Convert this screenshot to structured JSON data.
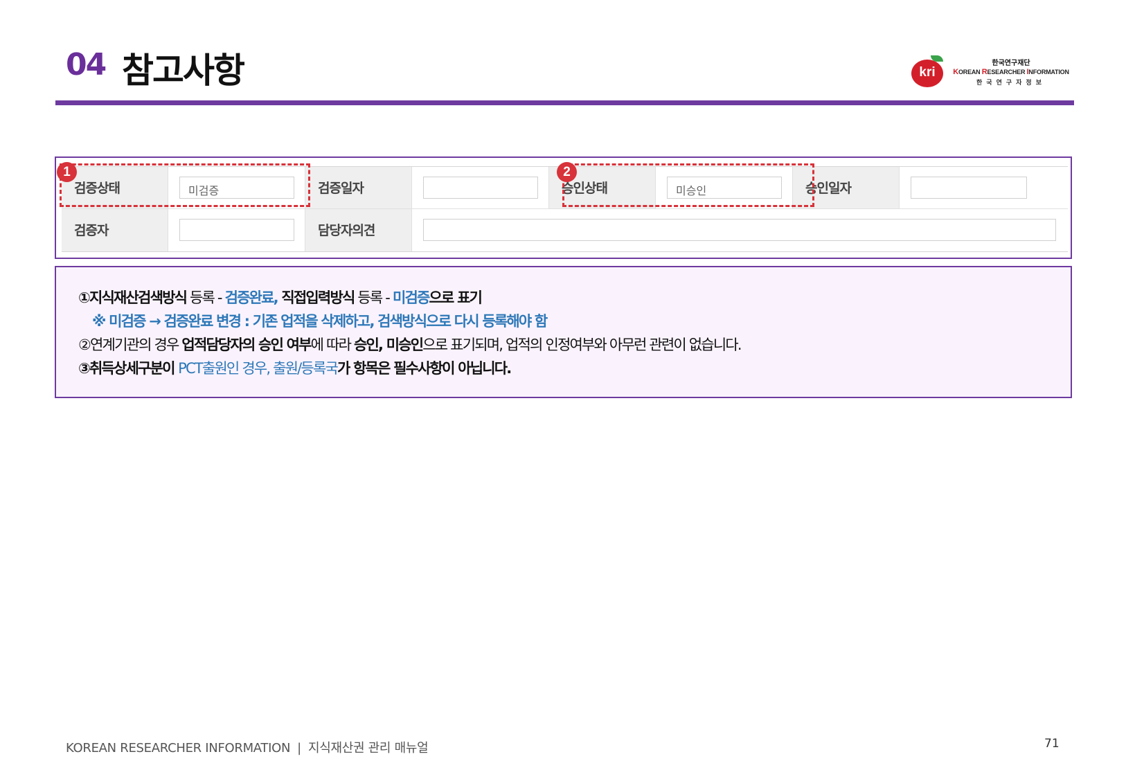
{
  "header": {
    "section_number": "04",
    "section_title": "참고사항"
  },
  "logo": {
    "mark": "kri",
    "korean_name": "한국연구재단",
    "english_prefix": "KOREAN RESEARCHER INFORMATION",
    "english_parts": [
      "K",
      "OREAN ",
      "R",
      "ESEARCHER ",
      "I",
      "NFORMATION"
    ],
    "korean_sub": "한국연구자정보",
    "colors": {
      "red": "#d31f2a",
      "leaf": "#3aa24a"
    }
  },
  "form": {
    "row1": [
      {
        "label": "검증상태",
        "value": "미검증"
      },
      {
        "label": "검증일자",
        "value": ""
      },
      {
        "label": "승인상태",
        "value": "미승인"
      },
      {
        "label": "승인일자",
        "value": ""
      }
    ],
    "row2": [
      {
        "label": "검증자",
        "value": ""
      },
      {
        "label": "담당자의견",
        "value": ""
      }
    ],
    "markers": [
      "1",
      "2"
    ]
  },
  "notes": {
    "line1": {
      "p1": "①지식재산검색방식",
      "p2": " 등록 - ",
      "p3": "검증완료,",
      "p4": " 직접입력방식",
      "p5": " 등록 - ",
      "p6": "미검증",
      "p7": "으로 표기"
    },
    "line2": "※ 미검증 → 검증완료 변경 : 기존 업적을 삭제하고, 검색방식으로 다시 등록해야 함",
    "line3": {
      "p1": "②연계기관의 경우 ",
      "p2": "업적담당자의 승인 여부",
      "p3": "에 따라 ",
      "p4": "승인, 미승인",
      "p5": "으로 표기되며, 업적의 인정여부와 아무런 관련이 없습니다."
    },
    "line4": {
      "p1": "③취득상세구분이 ",
      "p2": "PCT출원인 경우, 출원/등록국",
      "p3": "가 항목은 필수사항이 아닙니다."
    }
  },
  "footer": {
    "left": "KOREAN RESEARCHER INFORMATION",
    "separator": "|",
    "manual": "지식재산권 관리 매뉴얼",
    "page": "71"
  },
  "colors": {
    "accent_purple": "#6e3aa0",
    "highlight_red": "#d8323a",
    "note_blue": "#2d78b8",
    "note_bg": "#faf3fd"
  }
}
